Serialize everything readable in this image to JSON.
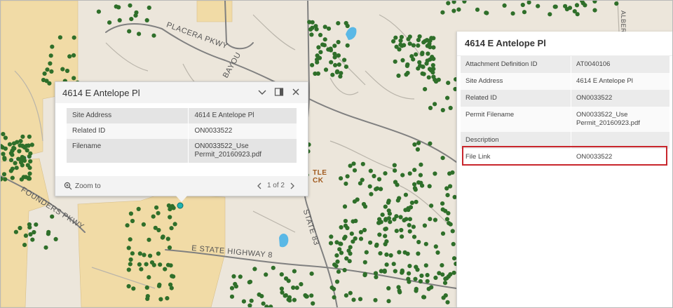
{
  "map": {
    "road_labels": {
      "placera_pkwy": "PLACERA PKWY",
      "bayou": "BAYOU",
      "founders_pkwy": "FOUNDERS PKWY",
      "e_state_highway": "E STATE HIGHWAY 8",
      "state_83": "STATE 83",
      "albert": "ALBERT"
    },
    "poi_label_line1": "TLE",
    "poi_label_line2": "CK",
    "colors": {
      "background": "#ece6db",
      "parcel_fill": "#f1dba6",
      "tree_dots": "#2f6f2a",
      "water": "#5ab8e6",
      "road": "#7f7f7f"
    }
  },
  "popup": {
    "title": "4614 E Antelope Pl",
    "rows": [
      {
        "label": "Site Address",
        "value": "4614 E Antelope Pl"
      },
      {
        "label": "Related ID",
        "value": "ON0033522"
      },
      {
        "label": "Filename",
        "value": "ON0033522_Use Permit_20160923.pdf"
      }
    ],
    "zoom_to": "Zoom to",
    "pagination": "1 of 2"
  },
  "panel": {
    "title": "4614 E Antelope Pl",
    "rows": [
      {
        "label": "Attachment Definition ID",
        "value": "AT0040106"
      },
      {
        "label": "Site Address",
        "value": "4614 E Antelope Pl"
      },
      {
        "label": "Related ID",
        "value": "ON0033522"
      },
      {
        "label": "Permit Filename",
        "value": "ON0033522_Use Permit_20160923.pdf"
      },
      {
        "label": "Description",
        "value": ""
      },
      {
        "label": "File Link",
        "value": "ON0033522"
      }
    ],
    "highlight_color": "#c8262c"
  }
}
